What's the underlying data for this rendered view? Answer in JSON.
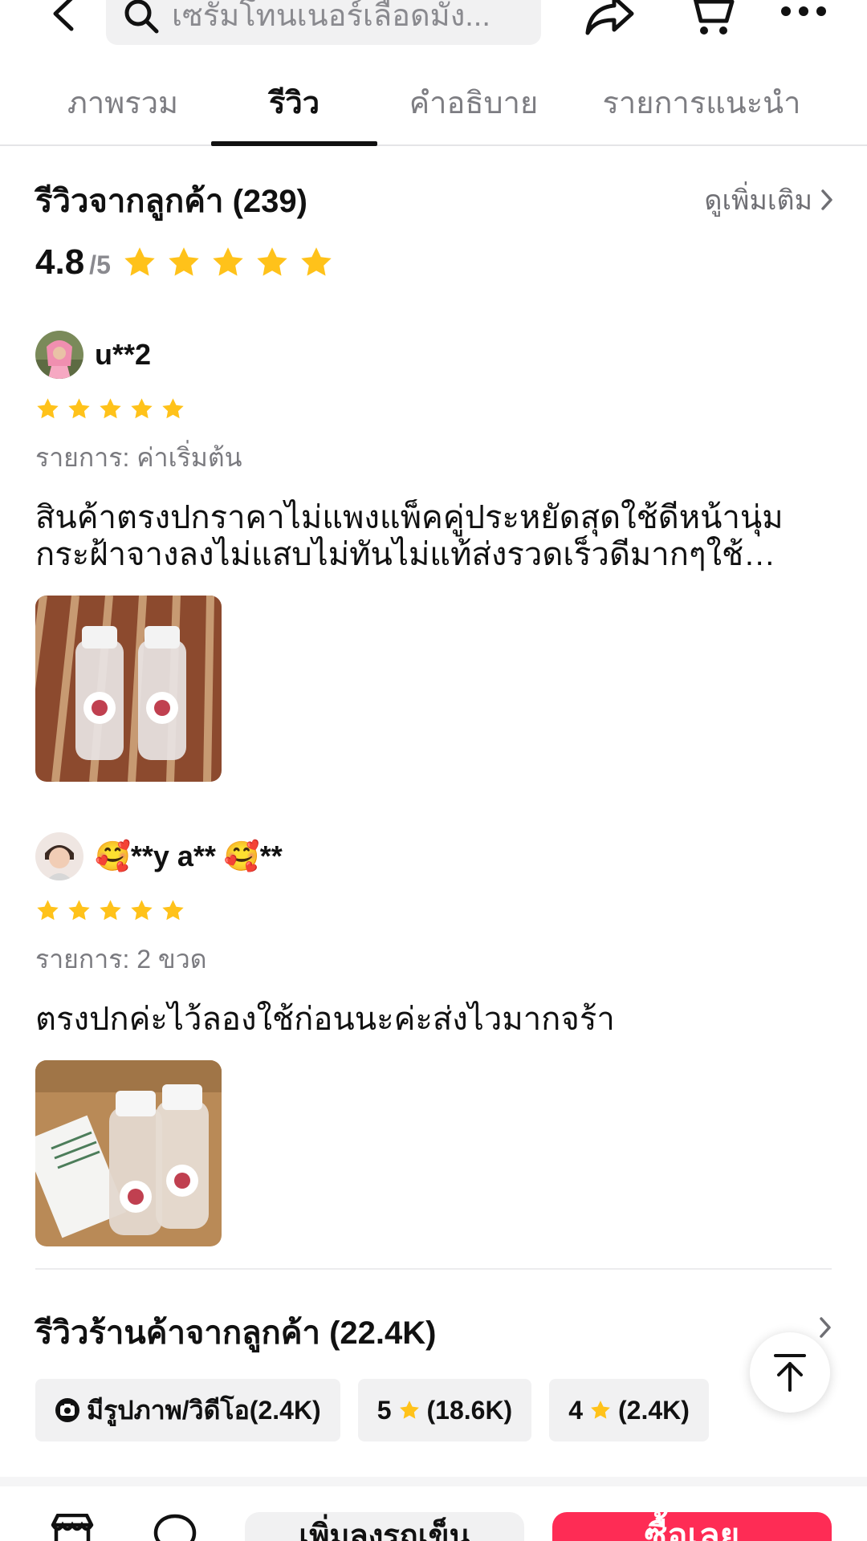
{
  "header": {
    "search_text": "เซรั่มโทนเนอร์เลือดมัง...",
    "icons": [
      "back-arrow-icon",
      "search-icon",
      "share-icon",
      "cart-icon",
      "more-icon"
    ]
  },
  "tabs": [
    {
      "label": "ภาพรวม",
      "active": false
    },
    {
      "label": "รีวิว",
      "active": true
    },
    {
      "label": "คำอธิบาย",
      "active": false
    },
    {
      "label": "รายการแนะนำ",
      "active": false
    }
  ],
  "reviews_section": {
    "title": "รีวิวจากลูกค้า (239)",
    "see_more": "ดูเพิ่มเติม",
    "rating": "4.8",
    "rating_max": "/5",
    "stars": 5
  },
  "reviews": [
    {
      "name": "u**2",
      "stars": 5,
      "variant": "รายการ: ค่าเริ่มต้น",
      "text": "สินค้าตรงปกราคาไม่แพงแพ็คคู่ประหยัดสุดใช้ดีหน้านุ่มกระฝ้าจางลงไม่แสบไม่ทันไม่แท้ส่งรวดเร็วดีมากๆใช้ประจำใช้ประจำค่ะ"
    },
    {
      "name": "🥰**y a** 🥰**",
      "stars": 5,
      "variant": "รายการ: 2 ขวด",
      "text": "ตรงปกค่ะไว้ลองใช้ก่อนนะค่ะส่งไวมากจร้า"
    }
  ],
  "shop_reviews": {
    "title": "รีวิวร้านค้าจากลูกค้า (22.4K)",
    "chips": [
      {
        "label": "มีรูปภาพ/วิดีโอ(2.4K)"
      },
      {
        "label_prefix": "5",
        "label_suffix": "(18.6K)"
      },
      {
        "label_prefix": "4",
        "label_suffix": "(2.4K)"
      }
    ]
  },
  "bottom_bar": {
    "add_to_cart": "เพิ่มลงรถเข็น",
    "buy_now": "ซื้อเลย"
  },
  "colors": {
    "star": "#FFC21A",
    "accent": "#FE2C55",
    "muted_text": "#7D7D82",
    "chip_bg": "#F1F1F2"
  }
}
